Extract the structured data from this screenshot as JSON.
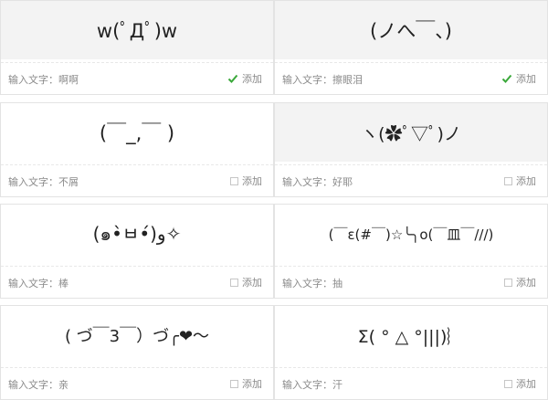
{
  "cards": [
    {
      "face": "w(ﾟДﾟ)w",
      "caption_prefix": "输入文字：",
      "caption_value": "啊啊",
      "add_label": "添加",
      "checked": true
    },
    {
      "face": "(ノへ￣、)",
      "caption_prefix": "输入文字：",
      "caption_value": "擦眼泪",
      "add_label": "添加",
      "checked": true
    },
    {
      "face": "(￣_,￣ )",
      "caption_prefix": "输入文字：",
      "caption_value": "不屑",
      "add_label": "添加",
      "checked": false
    },
    {
      "face": "ヽ(✿ﾟ▽ﾟ)ノ",
      "caption_prefix": "输入文字：",
      "caption_value": "好耶",
      "add_label": "添加",
      "checked": false
    },
    {
      "face": "(๑•̀ㅂ•́)و✧",
      "caption_prefix": "输入文字：",
      "caption_value": "棒",
      "add_label": "添加",
      "checked": false
    },
    {
      "face": "(￣ε(#￣)☆╰╮o(￣皿￣///)",
      "caption_prefix": "输入文字：",
      "caption_value": "抽",
      "add_label": "添加",
      "checked": false
    },
    {
      "face": "( づ￣3￣）づ╭❤～",
      "caption_prefix": "输入文字：",
      "caption_value": "亲",
      "add_label": "添加",
      "checked": false
    },
    {
      "face": "Σ( ° △ °|||)︴",
      "caption_prefix": "输入文字：",
      "caption_value": "汗",
      "add_label": "添加",
      "checked": false
    }
  ],
  "colors": {
    "check": "#3aa83a",
    "selected_bg": "#f3f3f3",
    "border": "#e3e3e3"
  },
  "icons": {
    "checked": "checkbox-checked-icon",
    "unchecked": "checkbox-empty-icon"
  }
}
